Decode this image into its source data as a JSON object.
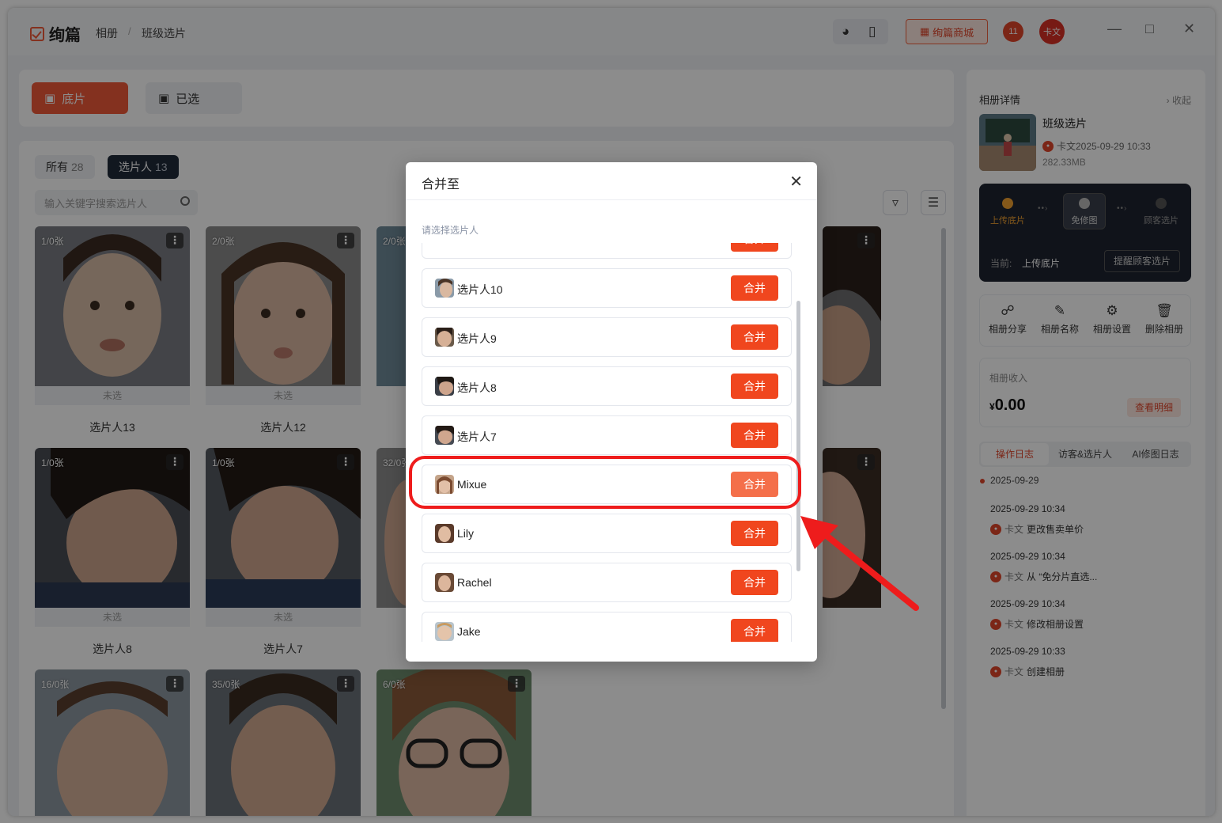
{
  "app": {
    "logo_text": "绚篇",
    "breadcrumb": [
      "相册",
      "班级选片"
    ],
    "mall_label": "绚篇商城",
    "notify_badge": "11",
    "user_avatar": "卡文"
  },
  "tabs": {
    "primary": "底片",
    "secondary": "已选"
  },
  "filters": {
    "all_label": "所有",
    "all_count": "28",
    "pickers_label": "选片人",
    "pickers_count": "13",
    "search_placeholder": "输入关键字搜索选片人"
  },
  "cards": [
    {
      "count": "1/0张",
      "status": "未选",
      "name": "选片人13"
    },
    {
      "count": "2/0张",
      "status": "未选",
      "name": "选片人12"
    },
    {
      "count": "2/0张"
    },
    {
      "count": "1/0张",
      "status": "未选",
      "name": "选片人8"
    },
    {
      "count": "1/0张",
      "status": "未选",
      "name": "选片人7"
    },
    {
      "count": "32/0张"
    },
    {
      "count": "16/0张"
    },
    {
      "count": "35/0张"
    },
    {
      "count": "6/0张"
    }
  ],
  "right_panel": {
    "title": "相册详情",
    "collapse": "收起",
    "album_name": "班级选片",
    "album_owner_date": "卡文2025-09-29 10:33",
    "album_size": "282.33MB",
    "steps": [
      "上传底片",
      "免修图",
      "顾客选片"
    ],
    "current_label": "当前:",
    "current_value": "上传底片",
    "remind_button": "提醒顾客选片",
    "actions": [
      "相册分享",
      "相册名称",
      "相册设置",
      "删除相册"
    ],
    "income_label": "相册收入",
    "income_currency": "¥",
    "income_value": "0.00",
    "income_detail": "查看明细",
    "log_tabs": [
      "操作日志",
      "访客&选片人",
      "AI修图日志"
    ],
    "log_date": "2025-09-29",
    "logs": [
      {
        "time": "2025-09-29 10:34",
        "who": "卡文",
        "what": "更改售卖单价"
      },
      {
        "time": "2025-09-29 10:34",
        "who": "卡文",
        "what": "从 “免分片直选..."
      },
      {
        "time": "2025-09-29 10:34",
        "who": "卡文",
        "what": "修改相册设置"
      },
      {
        "time": "2025-09-29 10:33",
        "who": "卡文",
        "what": "创建相册"
      }
    ]
  },
  "modal": {
    "title": "合并至",
    "hint": "请选择选片人",
    "merge_label": "合并",
    "rows": [
      {
        "name": "选片人10"
      },
      {
        "name": "选片人9"
      },
      {
        "name": "选片人8"
      },
      {
        "name": "选片人7"
      },
      {
        "name": "Mixue"
      },
      {
        "name": "Lily"
      },
      {
        "name": "Rachel"
      },
      {
        "name": "Jake"
      }
    ]
  },
  "colors": {
    "accent": "#f05a3a",
    "highlight": "#ee1c1c"
  },
  "icons": [
    "check-square-icon",
    "headset-icon",
    "phone-icon",
    "shop-icon",
    "image-icon",
    "image-check-icon",
    "search-icon",
    "filter-icon",
    "menu-icon",
    "more-icon",
    "share-icon",
    "edit-icon",
    "gear-icon",
    "trash-icon",
    "close-icon",
    "chevron-right-icon"
  ]
}
